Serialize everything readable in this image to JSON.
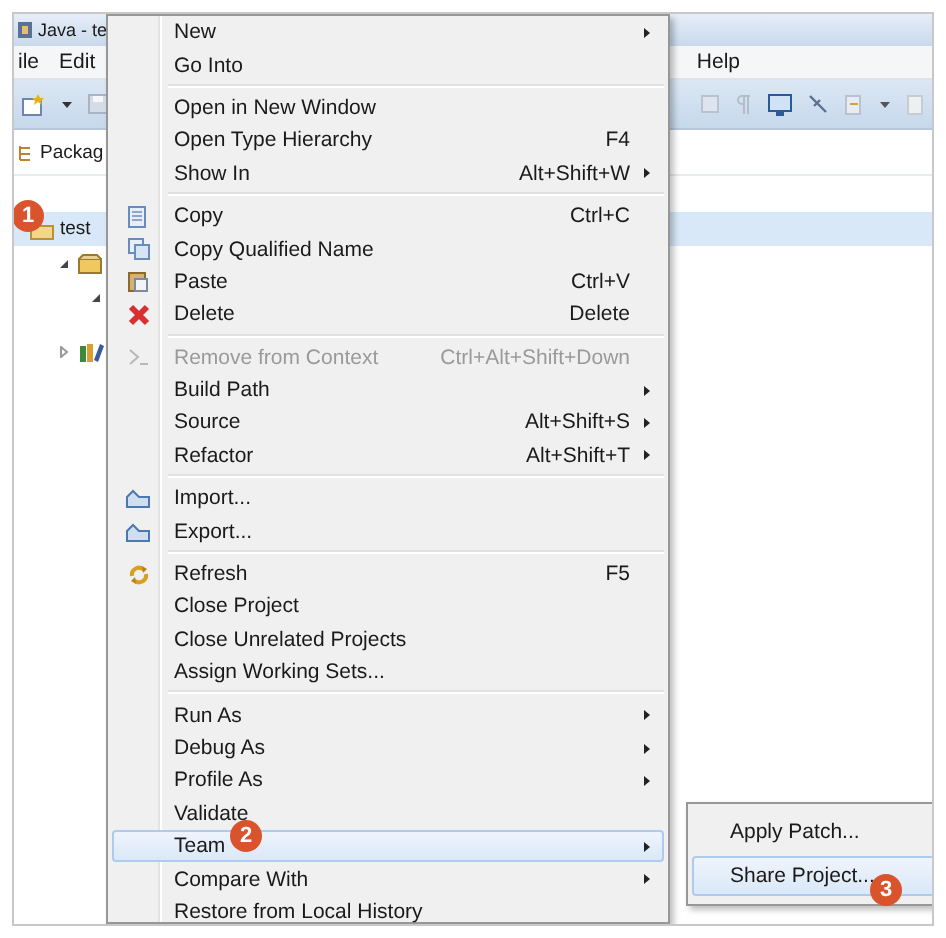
{
  "window": {
    "title": "Java - te"
  },
  "menubar": [
    {
      "label": "ile"
    },
    {
      "label": "Edit"
    },
    {
      "label": "Help"
    }
  ],
  "view_tab": {
    "label": "Packag"
  },
  "tree": [
    {
      "label": "test",
      "selected": true,
      "children": [
        {
          "expanded": true,
          "children": [
            {
              "expanded": true
            }
          ]
        },
        {
          "expanded": false
        }
      ]
    }
  ],
  "context_menu": [
    {
      "kind": "item",
      "label": "New",
      "submenu": true,
      "selected": false
    },
    {
      "kind": "item",
      "label": "Go Into",
      "selected": false
    },
    {
      "kind": "separator"
    },
    {
      "kind": "item",
      "label": "Open in New Window",
      "selected": false
    },
    {
      "kind": "item",
      "label": "Open Type Hierarchy",
      "shortcut": "F4",
      "selected": false
    },
    {
      "kind": "item",
      "label": "Show In",
      "shortcut": "Alt+Shift+W",
      "submenu": true,
      "selected": false
    },
    {
      "kind": "separator"
    },
    {
      "kind": "item",
      "label": "Copy",
      "shortcut": "Ctrl+C",
      "selected": false
    },
    {
      "kind": "item",
      "label": "Copy Qualified Name",
      "selected": false
    },
    {
      "kind": "item",
      "label": "Paste",
      "shortcut": "Ctrl+V",
      "selected": false
    },
    {
      "kind": "item",
      "label": "Delete",
      "shortcut": "Delete",
      "selected": false
    },
    {
      "kind": "separator"
    },
    {
      "kind": "item",
      "label": "Remove from Context",
      "shortcut": "Ctrl+Alt+Shift+Down",
      "disabled": true,
      "selected": false
    },
    {
      "kind": "item",
      "label": "Build Path",
      "submenu": true,
      "selected": false
    },
    {
      "kind": "item",
      "label": "Source",
      "shortcut": "Alt+Shift+S",
      "submenu": true,
      "selected": false
    },
    {
      "kind": "item",
      "label": "Refactor",
      "shortcut": "Alt+Shift+T",
      "submenu": true,
      "selected": false
    },
    {
      "kind": "separator"
    },
    {
      "kind": "item",
      "label": "Import...",
      "selected": false
    },
    {
      "kind": "item",
      "label": "Export...",
      "selected": false
    },
    {
      "kind": "separator"
    },
    {
      "kind": "item",
      "label": "Refresh",
      "shortcut": "F5",
      "selected": false
    },
    {
      "kind": "item",
      "label": "Close Project",
      "selected": false
    },
    {
      "kind": "item",
      "label": "Close Unrelated Projects",
      "selected": false
    },
    {
      "kind": "item",
      "label": "Assign Working Sets...",
      "selected": false
    },
    {
      "kind": "separator"
    },
    {
      "kind": "item",
      "label": "Run As",
      "submenu": true,
      "selected": false
    },
    {
      "kind": "item",
      "label": "Debug As",
      "submenu": true,
      "selected": false
    },
    {
      "kind": "item",
      "label": "Profile As",
      "submenu": true,
      "selected": false
    },
    {
      "kind": "item",
      "label": "Validate",
      "selected": false
    },
    {
      "kind": "item",
      "label": "Team",
      "submenu": true,
      "selected": true
    },
    {
      "kind": "item",
      "label": "Compare With",
      "submenu": true,
      "selected": false
    },
    {
      "kind": "item",
      "label": "Restore from Local History",
      "selected": false
    }
  ],
  "team_submenu": [
    {
      "label": "Apply Patch...",
      "selected": false
    },
    {
      "label": "Share Project...",
      "selected": true
    }
  ],
  "step_badges": [
    "1",
    "2",
    "3"
  ]
}
